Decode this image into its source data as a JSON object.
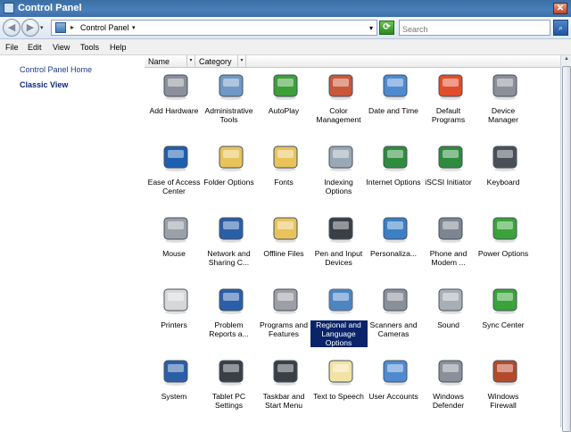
{
  "window": {
    "title": "Control Panel",
    "close_label": "✕"
  },
  "address": {
    "back_label": "◀",
    "forward_label": "▶",
    "nav_dropdown": "▾",
    "crumb_arrow": "▸",
    "crumb": "Control Panel",
    "crumb_dropdown": "▾",
    "history_dropdown": "▾",
    "refresh_label": "⟳"
  },
  "search": {
    "placeholder": "Search",
    "button_label": "⌕"
  },
  "menu": {
    "items": [
      "File",
      "Edit",
      "View",
      "Tools",
      "Help"
    ]
  },
  "left_pane": {
    "home": "Control Panel Home",
    "classic": "Classic View"
  },
  "columns": [
    {
      "label": "Name",
      "dropdown": "▾"
    },
    {
      "label": "Category",
      "dropdown": "▾"
    }
  ],
  "scrollbar": {
    "up": "▲"
  },
  "items": [
    {
      "label": "Add Hardware",
      "icon": "add-hardware-icon",
      "color": "#8a8f99"
    },
    {
      "label": "Administrative Tools",
      "icon": "administrative-tools-icon",
      "color": "#6f98c4"
    },
    {
      "label": "AutoPlay",
      "icon": "autoplay-icon",
      "color": "#3d9f3a"
    },
    {
      "label": "Color Management",
      "icon": "color-management-icon",
      "color": "#c9573a"
    },
    {
      "label": "Date and Time",
      "icon": "date-time-icon",
      "color": "#4f8ad1"
    },
    {
      "label": "Default Programs",
      "icon": "default-programs-icon",
      "color": "#e14d2a"
    },
    {
      "label": "Device Manager",
      "icon": "device-manager-icon",
      "color": "#8a8f99"
    },
    {
      "label": "Ease of Access Center",
      "icon": "ease-of-access-icon",
      "color": "#1f5fb0"
    },
    {
      "label": "Folder Options",
      "icon": "folder-options-icon",
      "color": "#e8c35a"
    },
    {
      "label": "Fonts",
      "icon": "fonts-icon",
      "color": "#e8c35a"
    },
    {
      "label": "Indexing Options",
      "icon": "indexing-options-icon",
      "color": "#9aa7b5"
    },
    {
      "label": "Internet Options",
      "icon": "internet-options-icon",
      "color": "#2f8b3d"
    },
    {
      "label": "iSCSI Initiator",
      "icon": "iscsi-initiator-icon",
      "color": "#2f8b3d"
    },
    {
      "label": "Keyboard",
      "icon": "keyboard-icon",
      "color": "#4a4f57"
    },
    {
      "label": "Mouse",
      "icon": "mouse-icon",
      "color": "#9aa0a8"
    },
    {
      "label": "Network and Sharing C...",
      "icon": "network-sharing-icon",
      "color": "#2a5fa8"
    },
    {
      "label": "Offline Files",
      "icon": "offline-files-icon",
      "color": "#e8c35a"
    },
    {
      "label": "Pen and Input Devices",
      "icon": "pen-input-icon",
      "color": "#3a3f46"
    },
    {
      "label": "Personaliza...",
      "icon": "personalization-icon",
      "color": "#3b7fc4"
    },
    {
      "label": "Phone and Modem ...",
      "icon": "phone-modem-icon",
      "color": "#7d8590"
    },
    {
      "label": "Power Options",
      "icon": "power-options-icon",
      "color": "#3aa33a"
    },
    {
      "label": "Printers",
      "icon": "printers-icon",
      "color": "#d7d7d7"
    },
    {
      "label": "Problem Reports a...",
      "icon": "problem-reports-icon",
      "color": "#2a5fa8"
    },
    {
      "label": "Programs and Features",
      "icon": "programs-features-icon",
      "color": "#9e9ea6"
    },
    {
      "label": "Regional and Language Options",
      "icon": "regional-language-icon",
      "color": "#2f6fb8"
    },
    {
      "label": "Scanners and Cameras",
      "icon": "scanners-cameras-icon",
      "color": "#8a8f99"
    },
    {
      "label": "Sound",
      "icon": "sound-icon",
      "color": "#a8aeb6"
    },
    {
      "label": "Sync Center",
      "icon": "sync-center-icon",
      "color": "#3aa33a"
    },
    {
      "label": "System",
      "icon": "system-icon",
      "color": "#2a5fa8"
    },
    {
      "label": "Tablet PC Settings",
      "icon": "tablet-pc-icon",
      "color": "#3a3f46"
    },
    {
      "label": "Taskbar and Start Menu",
      "icon": "taskbar-start-icon",
      "color": "#3a3f46"
    },
    {
      "label": "Text to Speech",
      "icon": "text-to-speech-icon",
      "color": "#f2e3a2"
    },
    {
      "label": "User Accounts",
      "icon": "user-accounts-icon",
      "color": "#4f8ad1"
    },
    {
      "label": "Windows Defender",
      "icon": "windows-defender-icon",
      "color": "#8a8f99"
    },
    {
      "label": "Windows Firewall",
      "icon": "windows-firewall-icon",
      "color": "#b54a2a"
    }
  ],
  "selected_item": "Regional and Language Options"
}
